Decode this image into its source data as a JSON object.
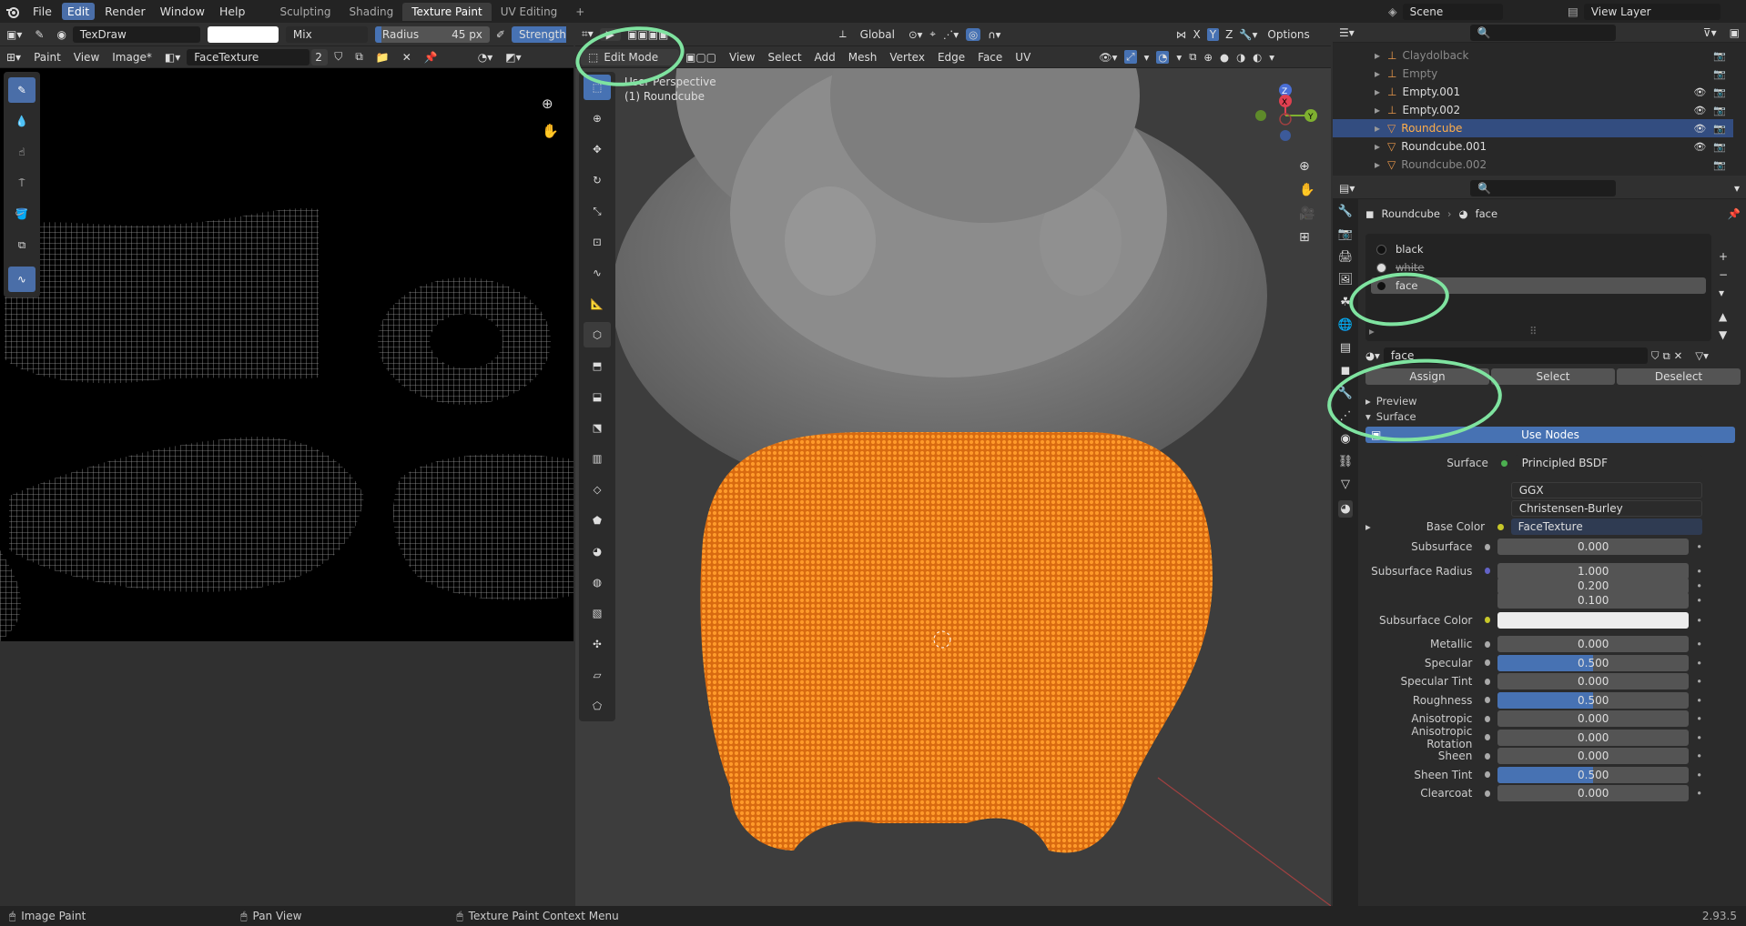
{
  "topbar": {
    "menus": [
      "File",
      "Edit",
      "Render",
      "Window",
      "Help"
    ],
    "active_menu": "Edit",
    "workspaces": [
      "Sculpting",
      "Shading",
      "Texture Paint",
      "UV Editing"
    ],
    "active_workspace": "Texture Paint",
    "scene": "Scene",
    "view_layer": "View Layer"
  },
  "image_editor": {
    "brush": "TexDraw",
    "blend": "Mix",
    "radius_label": "Radius",
    "radius_value": "45 px",
    "strength_label": "Strength",
    "mode": "Paint",
    "menus": [
      "View",
      "Image*"
    ],
    "image_name": "FaceTexture",
    "image_users": "2"
  },
  "viewport": {
    "mode": "Edit Mode",
    "menus": [
      "View",
      "Select",
      "Add",
      "Mesh",
      "Vertex",
      "Edge",
      "Face",
      "UV"
    ],
    "transform": "Global",
    "options": "Options",
    "overlay_line1": "User Perspective",
    "overlay_line2": "(1) Roundcube",
    "axes": [
      "X",
      "Y",
      "Z"
    ]
  },
  "outliner": {
    "items": [
      {
        "name": "Claydolback",
        "dim": true
      },
      {
        "name": "Empty",
        "dim": true
      },
      {
        "name": "Empty.001",
        "dim": false
      },
      {
        "name": "Empty.002",
        "dim": false
      },
      {
        "name": "Roundcube",
        "dim": false,
        "selected": true
      },
      {
        "name": "Roundcube.001",
        "dim": false
      },
      {
        "name": "Roundcube.002",
        "dim": true
      }
    ]
  },
  "properties": {
    "object": "Roundcube",
    "material": "face",
    "slots": [
      "black",
      "white",
      "face"
    ],
    "active_slot": "face",
    "material_field": "face",
    "assign": "Assign",
    "select": "Select",
    "deselect": "Deselect",
    "preview": "Preview",
    "surface_panel": "Surface",
    "use_nodes": "Use Nodes",
    "surface_label": "Surface",
    "surface_value": "Principled BSDF",
    "distribution": "GGX",
    "subsurface_method": "Christensen-Burley",
    "base_color_label": "Base Color",
    "base_color_value": "FaceTexture",
    "rows": [
      {
        "label": "Subsurface",
        "value": "0.000",
        "fill": 0
      },
      {
        "label": "Subsurface Radius",
        "value": "1.000",
        "fill": 0
      },
      {
        "label": "",
        "value": "0.200",
        "fill": 0
      },
      {
        "label": "",
        "value": "0.100",
        "fill": 0
      },
      {
        "label": "Subsurface Color",
        "value": "",
        "fill": 0
      },
      {
        "label": "Metallic",
        "value": "0.000",
        "fill": 0
      },
      {
        "label": "Specular",
        "value": "0.500",
        "fill": 0.5
      },
      {
        "label": "Specular Tint",
        "value": "0.000",
        "fill": 0
      },
      {
        "label": "Roughness",
        "value": "0.500",
        "fill": 0.5
      },
      {
        "label": "Anisotropic",
        "value": "0.000",
        "fill": 0
      },
      {
        "label": "Anisotropic Rotation",
        "value": "0.000",
        "fill": 0
      },
      {
        "label": "Sheen",
        "value": "0.000",
        "fill": 0
      },
      {
        "label": "Sheen Tint",
        "value": "0.500",
        "fill": 0.5
      },
      {
        "label": "Clearcoat",
        "value": "0.000",
        "fill": 0
      }
    ]
  },
  "status": {
    "item1": "Image Paint",
    "item2": "Pan View",
    "item3": "Texture Paint Context Menu",
    "version": "2.93.5"
  },
  "colors": {
    "accent": "#4772b3",
    "selection": "#ff8a1a",
    "highlight_circle": "#7fe3a0"
  }
}
